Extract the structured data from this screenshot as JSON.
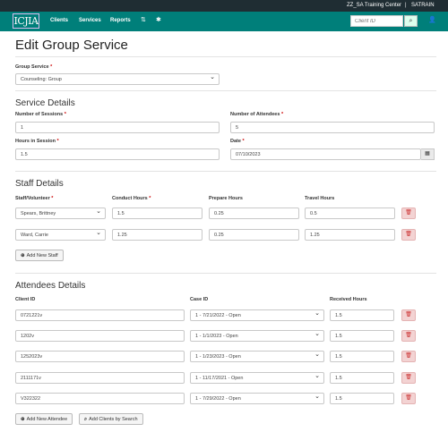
{
  "topbar": {
    "org": "ZZ_SA Training Center",
    "separator": "|",
    "user": "SATRAIN"
  },
  "nav": {
    "logo": "ICJIA",
    "items": [
      "Clients",
      "Services",
      "Reports"
    ],
    "sort_icon": "sort-icon",
    "settings_icon": "gear-icon",
    "search_placeholder": "Client ID",
    "search_icon": "search-icon",
    "user_icon": "user-icon"
  },
  "page": {
    "title": "Edit Group Service"
  },
  "group_service": {
    "label": "Group Service",
    "value": "Counseling: Group"
  },
  "service_details": {
    "heading": "Service Details",
    "sessions_label": "Number of Sessions",
    "sessions_value": "1",
    "attendees_label": "Number of Attendees",
    "attendees_value": "5",
    "hours_label": "Hours in Session",
    "hours_value": "1.5",
    "date_label": "Date",
    "date_value": "07/10/2023"
  },
  "staff_details": {
    "heading": "Staff Details",
    "columns": [
      "Staff/Volunteer",
      "Conduct Hours",
      "Prepare Hours",
      "Travel Hours"
    ],
    "rows": [
      {
        "staff": "Spears, Brittney",
        "conduct": "1.5",
        "prepare": "0.25",
        "travel": "0.5"
      },
      {
        "staff": "Ward, Carrie",
        "conduct": "1.25",
        "prepare": "0.25",
        "travel": "1.25"
      }
    ],
    "add_button": "Add New Staff"
  },
  "attendees_details": {
    "heading": "Attendees Details",
    "columns": [
      "Client ID",
      "Case ID",
      "Received Hours"
    ],
    "rows": [
      {
        "client": "0721221v",
        "case": "1 - 7/21/2022 - Open",
        "hours": "1.5"
      },
      {
        "client": "1202v",
        "case": "1 - 1/1/2023 - Open",
        "hours": "1.5"
      },
      {
        "client": "1252023v",
        "case": "1 - 1/23/2023 - Open",
        "hours": "1.5"
      },
      {
        "client": "2111171v",
        "case": "1 - 11/17/2021 - Open",
        "hours": "1.5"
      },
      {
        "client": "V322322",
        "case": "1 - 7/29/2022 - Open",
        "hours": "1.5"
      }
    ],
    "add_attendee_button": "Add New Attendee",
    "add_search_button": "Add Clients by Search"
  },
  "required_marker": "*",
  "colors": {
    "nav": "#007f7a",
    "topbar": "#1f2d33",
    "delete": "#f3d3d3"
  }
}
